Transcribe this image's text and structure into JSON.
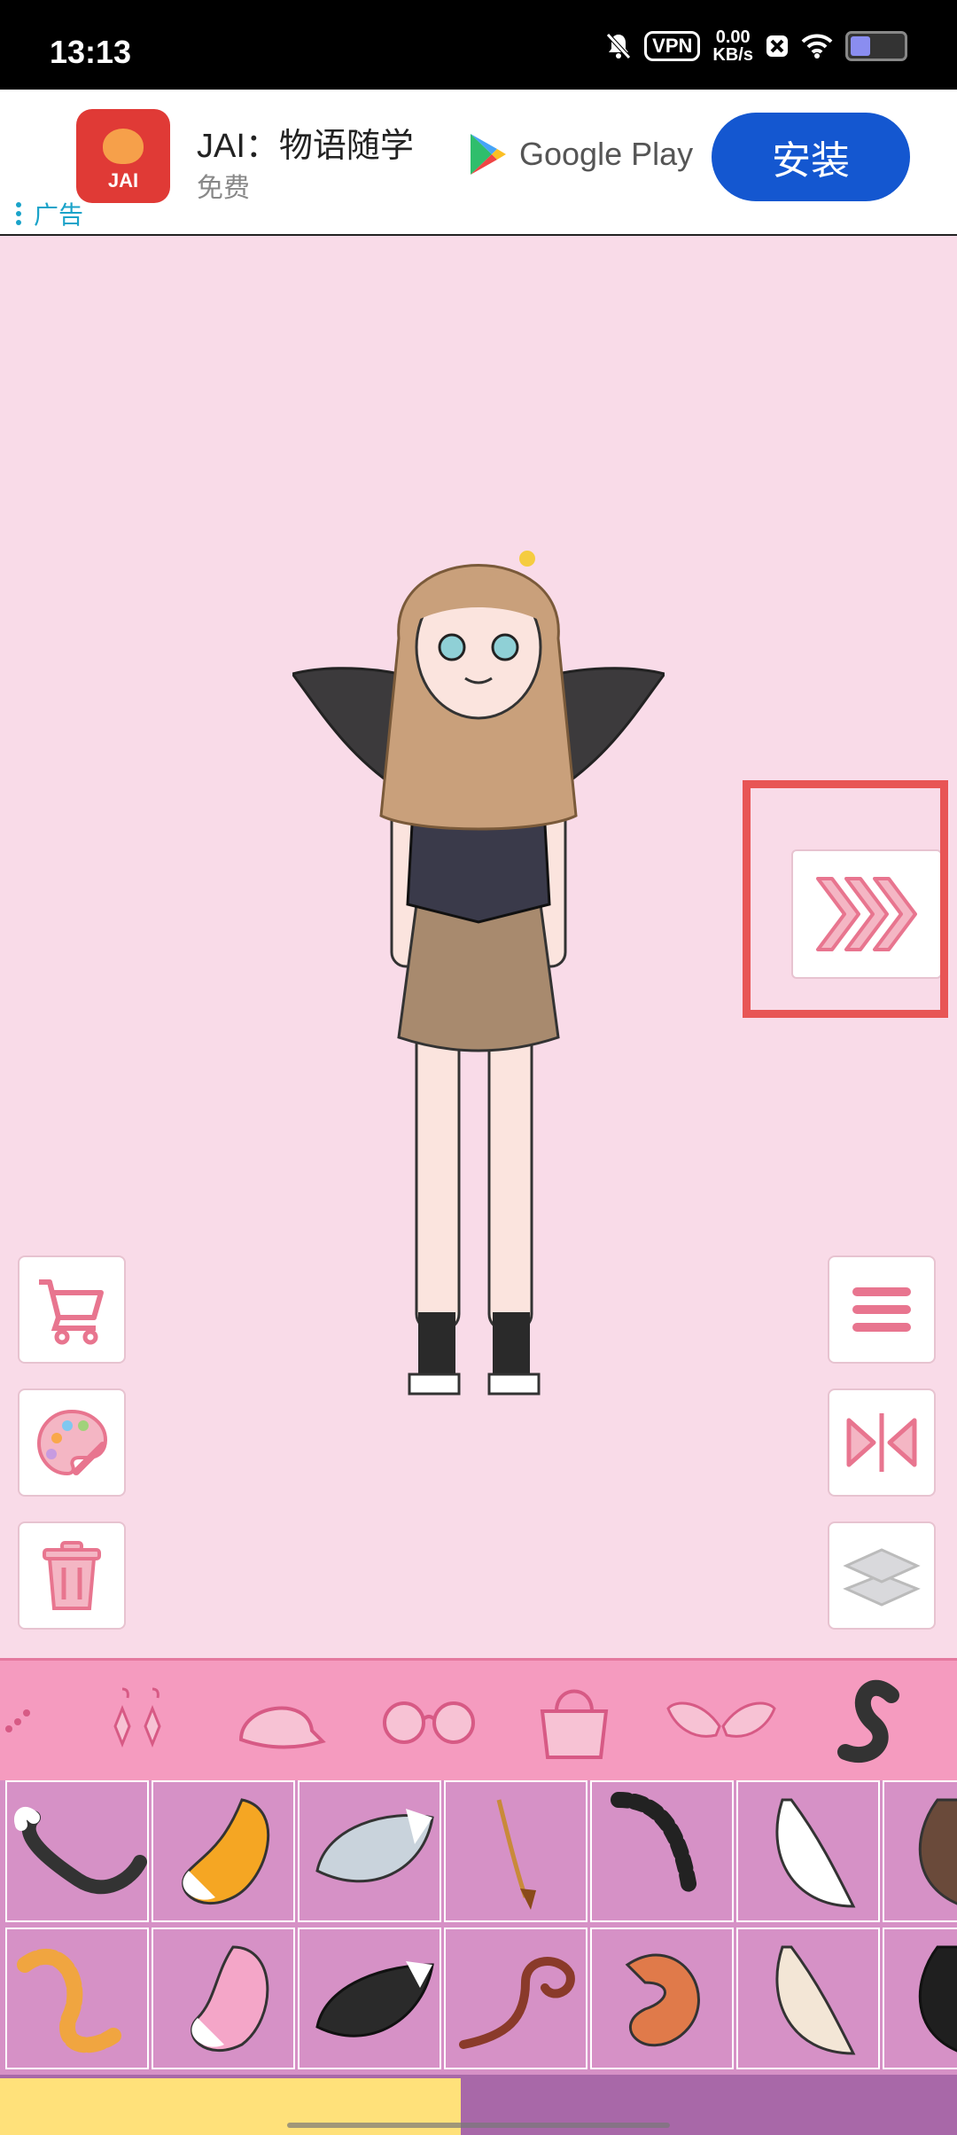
{
  "status_bar": {
    "time": "13:13",
    "vpn": "VPN",
    "speed_value": "0.00",
    "speed_unit": "KB/s"
  },
  "ad": {
    "app_icon_text": "JAI",
    "app_name": "JAI：物语随学",
    "price": "免费",
    "store": "Google Play",
    "install_label": "安装",
    "ad_label": "广告"
  },
  "colors": {
    "background": "#f9dbe8",
    "accent_pink": "#e8758f",
    "category_bar": "#f59bbf",
    "items_panel": "#d691c6",
    "highlight_box": "#e85555",
    "install_button": "#1457d0"
  },
  "left_buttons": [
    "cart-icon",
    "palette-icon",
    "trash-icon"
  ],
  "right_buttons": [
    "menu-icon",
    "flip-icon",
    "layers-icon"
  ],
  "next_button_icon": "triple-chevron-right-icon",
  "categories": [
    "necklace-icon",
    "earrings-icon",
    "cap-icon",
    "glasses-icon",
    "bag-icon",
    "wings-icon",
    "tail-icon"
  ],
  "selected_category": "tail-icon",
  "tail_items_count": 14
}
